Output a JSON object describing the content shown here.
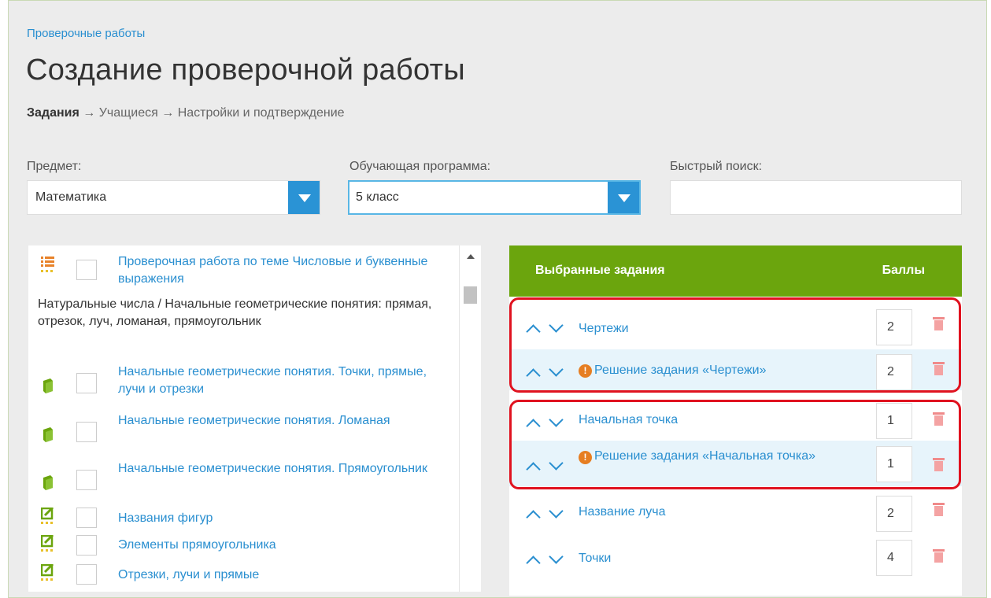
{
  "breadcrumb": "Проверочные работы",
  "page_title": "Создание проверочной работы",
  "steps": {
    "current": "Задания",
    "arrow": "→",
    "second": "Учащиеся",
    "third": "Настройки и подтверждение"
  },
  "filters": {
    "subject_label": "Предмет:",
    "subject_value": "Математика",
    "program_label": "Обучающая программа:",
    "program_value": "5 класс",
    "search_label": "Быстрый поиск:",
    "search_value": ""
  },
  "left_list": {
    "top_item": "Проверочная работа по теме Числовые и буквенные выражения",
    "section_text": "Натуральные числа / Начальные геометрические понятия: прямая, отрезок, луч, ломаная, прямоугольник",
    "items": [
      {
        "label": "Начальные геометрические понятия. Точки, прямые, лучи и отрезки",
        "icon": "book-icon"
      },
      {
        "label": "Начальные геометрические понятия. Ломаная",
        "icon": "book-icon"
      },
      {
        "label": "Начальные геометрические понятия. Прямоугольник",
        "icon": "book-icon"
      },
      {
        "label": "Названия фигур",
        "icon": "edit-task-icon"
      },
      {
        "label": "Элементы прямоугольника",
        "icon": "edit-task-icon"
      },
      {
        "label": "Отрезки, лучи и прямые",
        "icon": "edit-task-icon"
      }
    ]
  },
  "selected": {
    "header_title": "Выбранные задания",
    "header_points": "Баллы",
    "rows": [
      {
        "label": "Чертежи",
        "points": "2",
        "solution": false
      },
      {
        "label": "Решение задания «Чертежи»",
        "points": "2",
        "solution": true
      },
      {
        "label": "Начальная точка",
        "points": "1",
        "solution": false
      },
      {
        "label": "Решение задания «Начальная точка»",
        "points": "1",
        "solution": true
      },
      {
        "label": "Название луча",
        "points": "2",
        "solution": false
      },
      {
        "label": "Точки",
        "points": "4",
        "solution": false
      }
    ]
  },
  "colors": {
    "accent_blue": "#2a8fd0",
    "header_green": "#6ba50d",
    "highlight_red": "#e0121f",
    "warning_orange": "#e67e22"
  }
}
